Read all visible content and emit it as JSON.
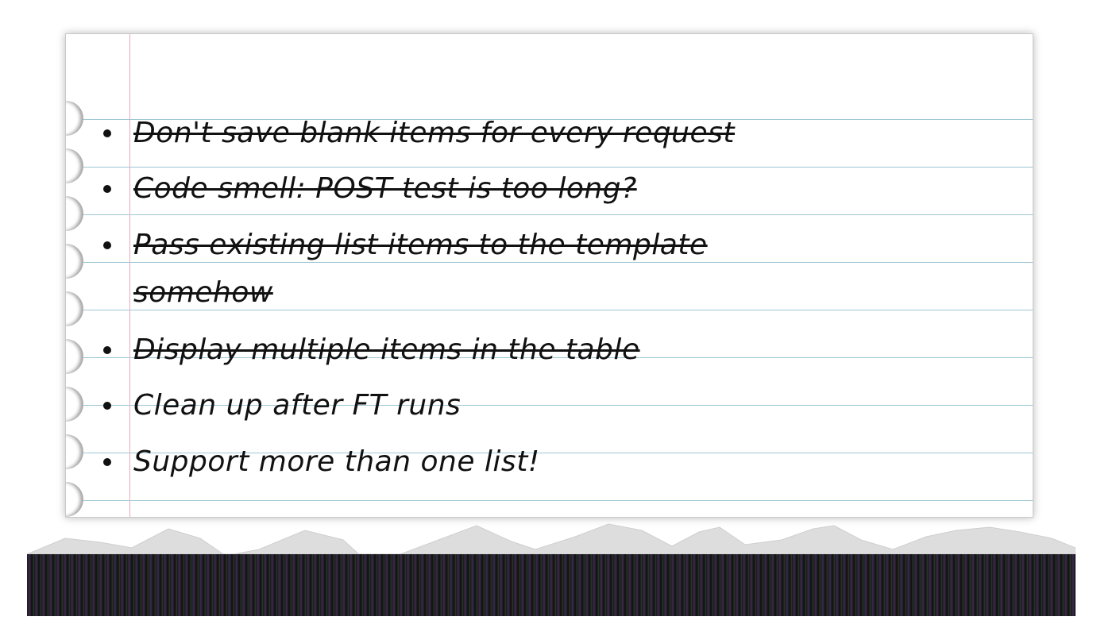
{
  "todo_items": [
    {
      "text": "Don't save blank items for every request",
      "done": true
    },
    {
      "text": "Code smell: POST test is too long?",
      "done": true
    },
    {
      "text": "Pass existing list items to the template somehow",
      "done": true
    },
    {
      "text": "Display multiple items in the table",
      "done": true
    },
    {
      "text": "Clean up after FT runs",
      "done": false
    },
    {
      "text": "Support more than one list!",
      "done": false
    }
  ],
  "colors": {
    "rule_lines": "#9ec7d4",
    "margin_line": "#e7a9c2",
    "ink": "#111111",
    "paper": "#ffffff"
  }
}
